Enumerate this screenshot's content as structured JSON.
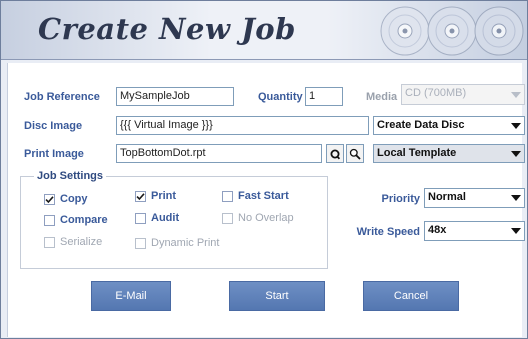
{
  "header": {
    "title": "Create New Job"
  },
  "job_reference": {
    "label": "Job Reference",
    "value": "MySampleJob"
  },
  "quantity": {
    "label": "Quantity",
    "value": "1"
  },
  "media": {
    "label": "Media",
    "value": "CD (700MB)"
  },
  "disc_image": {
    "label": "Disc Image",
    "value": "{{{ Virtual Image }}}",
    "mode": "Create Data Disc"
  },
  "print_image": {
    "label": "Print Image",
    "value": "TopBottomDot.rpt",
    "template": "Local Template"
  },
  "job_settings": {
    "title": "Job Settings",
    "copy": "Copy",
    "print": "Print",
    "fast_start": "Fast Start",
    "compare": "Compare",
    "audit": "Audit",
    "no_overlap": "No Overlap",
    "serialize": "Serialize",
    "dynamic_print": "Dynamic Print"
  },
  "priority": {
    "label": "Priority",
    "value": "Normal"
  },
  "write_speed": {
    "label": "Write Speed",
    "value": "48x"
  },
  "buttons": {
    "email": "E-Mail",
    "start": "Start",
    "cancel": "Cancel"
  },
  "colors": {
    "accent": "#3a5a9a",
    "button": "#5e80ba"
  }
}
